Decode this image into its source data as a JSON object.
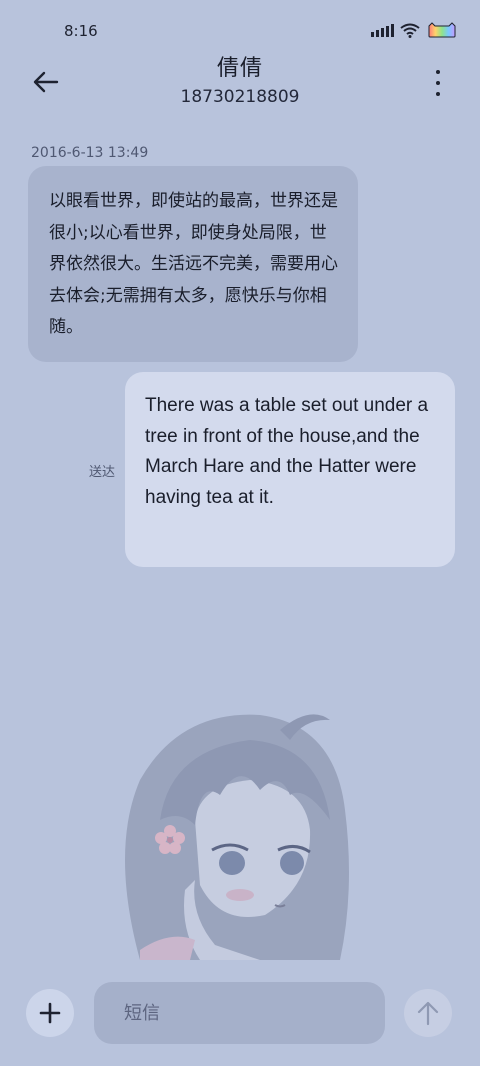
{
  "status_bar": {
    "time": "8:16",
    "icons": [
      "signal-icon",
      "wifi-icon",
      "battery-icon"
    ]
  },
  "header": {
    "back_icon": "arrow-left-icon",
    "contact_name": "倩倩",
    "contact_number": "18730218809",
    "more_icon": "more-vertical-icon"
  },
  "conversation": {
    "timestamp": "2016-6-13 13:49",
    "messages": [
      {
        "direction": "incoming",
        "text": "以眼看世界，即使站的最高，世界还是很小;以心看世界，即使身处局限，世界依然很大。生活远不完美，需要用心去体会;无需拥有太多，愿快乐与你相随。"
      },
      {
        "direction": "outgoing",
        "text": "There was a table set out under a tree in front of the house,and the March Hare and the Hatter were having tea at it.",
        "status": "送达"
      }
    ]
  },
  "composer": {
    "add_icon": "plus-icon",
    "placeholder": "短信",
    "value": "",
    "send_icon": "arrow-up-icon"
  },
  "colors": {
    "background": "#b8c3dc",
    "incoming_bubble": "#a8b3cd",
    "outgoing_bubble": "#d3daed",
    "secondary_text": "#4f5872"
  }
}
